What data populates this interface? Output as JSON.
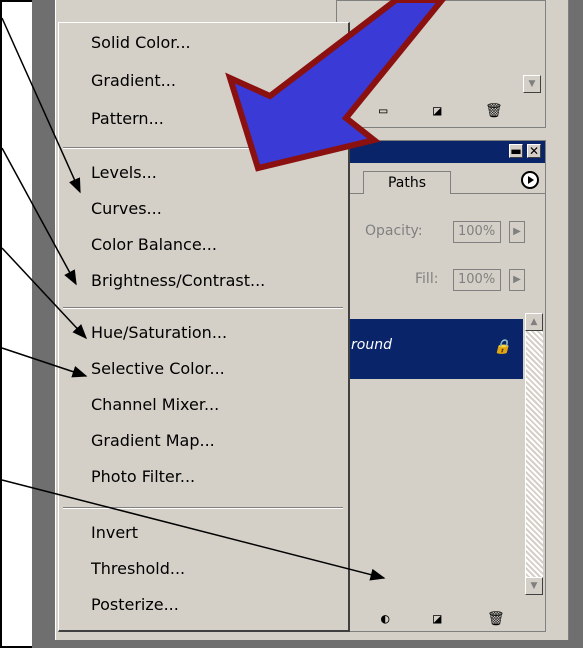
{
  "menu": {
    "groups": [
      [
        "Solid Color...",
        "Gradient...",
        "Pattern..."
      ],
      [
        "Levels...",
        "Curves...",
        "Color Balance...",
        "Brightness/Contrast..."
      ],
      [
        "Hue/Saturation...",
        "Selective Color...",
        "Channel Mixer...",
        "Gradient Map...",
        "Photo Filter..."
      ],
      [
        "Invert",
        "Threshold...",
        "Posterize..."
      ]
    ]
  },
  "layers_panel": {
    "tab_label": "Paths",
    "opacity_label": "Opacity:",
    "opacity_value": "100%",
    "fill_label": "Fill:",
    "fill_value": "100%",
    "layer_name": "round",
    "minimize_glyph": "▬",
    "close_glyph": "✕"
  },
  "icons": [
    "folder-icon",
    "new-layer-icon",
    "trash-icon",
    "lock-icon",
    "adjustment-layer-icon",
    "scroll-up-icon",
    "scroll-down-icon",
    "flyout-arrow-icon"
  ],
  "colors": {
    "title_bar": "#0a246a",
    "selected_layer": "#0a246a",
    "callout_arrow_fill": "#3a3ad6",
    "callout_arrow_stroke": "#8b1010",
    "ui_gray": "#d4d0c8"
  }
}
